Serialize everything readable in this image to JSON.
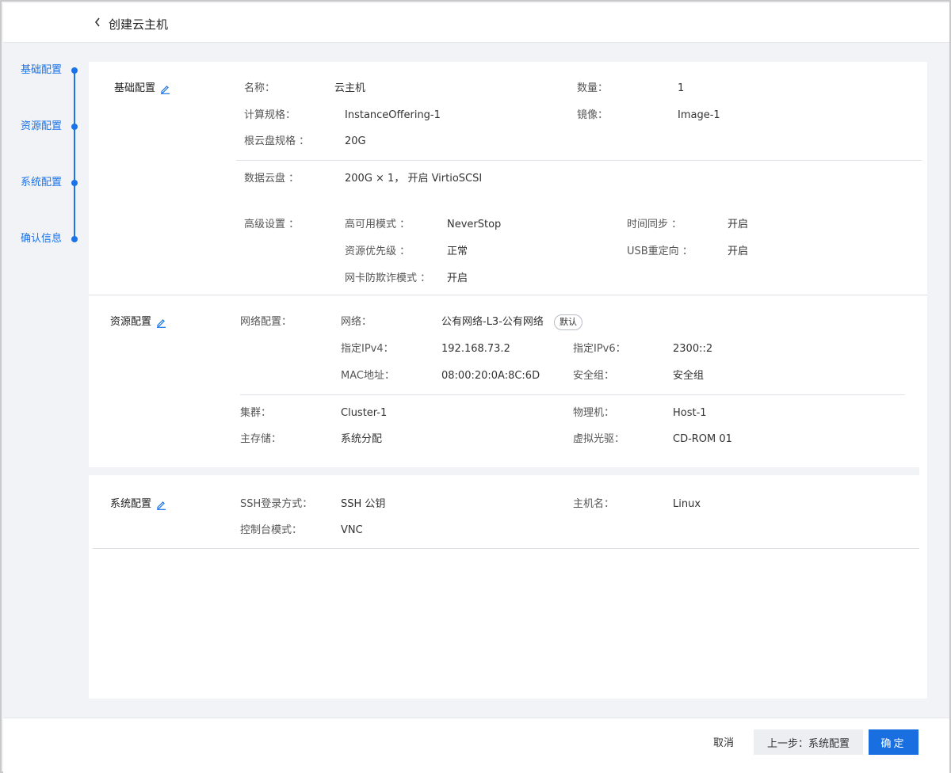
{
  "header": {
    "title": "创建云主机",
    "back_icon": "chevron-left-icon"
  },
  "steps": [
    {
      "label": "基础配置"
    },
    {
      "label": "资源配置"
    },
    {
      "label": "系统配置"
    },
    {
      "label": "确认信息"
    }
  ],
  "accent_color": "#1a73e8",
  "basic": {
    "title": "基础配置",
    "name_label": "名称：",
    "name_value": "云主机",
    "count_label": "数量：",
    "count_value": "1",
    "offering_label": "计算规格：",
    "offering_value": "InstanceOffering-1",
    "image_label": "镜像：",
    "image_value": "Image-1",
    "root_disk_label": "根云盘规格 ：",
    "root_disk_value": "20G",
    "data_disk_label": "数据云盘 ：",
    "data_disk_value": "200G × 1， 开启 VirtioSCSI",
    "advanced_label": "高级设置 ：",
    "ha_label": "高可用模式 ：",
    "ha_value": "NeverStop",
    "time_sync_label": "时间同步 ：",
    "time_sync_value": "开启",
    "priority_label": "资源优先级 ：",
    "priority_value": "正常",
    "usb_label": "USB重定向 ：",
    "usb_value": "开启",
    "nic_spoof_label": "网卡防欺诈模式 ：",
    "nic_spoof_value": "开启"
  },
  "resource": {
    "title": "资源配置",
    "network_config_label": "网络配置：",
    "network_label": "网络：",
    "network_value": "公有网络-L3-公有网络",
    "network_badge": "默认",
    "ipv4_label": "指定IPv4：",
    "ipv4_value": "192.168.73.2",
    "ipv6_label": "指定IPv6：",
    "ipv6_value": "2300::2",
    "mac_label": "MAC地址：",
    "mac_value": "08:00:20:0A:8C:6D",
    "security_group_label": "安全组：",
    "security_group_value": "安全组",
    "cluster_label": "集群：",
    "cluster_value": "Cluster-1",
    "host_label": "物理机：",
    "host_value": "Host-1",
    "primary_storage_label": "主存储：",
    "primary_storage_value": "系统分配",
    "cdrom_label": "虚拟光驱：",
    "cdrom_value": "CD-ROM 01"
  },
  "system": {
    "title": "系统配置",
    "ssh_label": "SSH登录方式：",
    "ssh_value": "SSH 公钥",
    "hostname_label": "主机名：",
    "hostname_value": "Linux",
    "console_label": "控制台模式：",
    "console_value": "VNC"
  },
  "footer": {
    "cancel_label": "取消",
    "prev_label": "上一步：系统配置",
    "ok_label": "确定"
  }
}
